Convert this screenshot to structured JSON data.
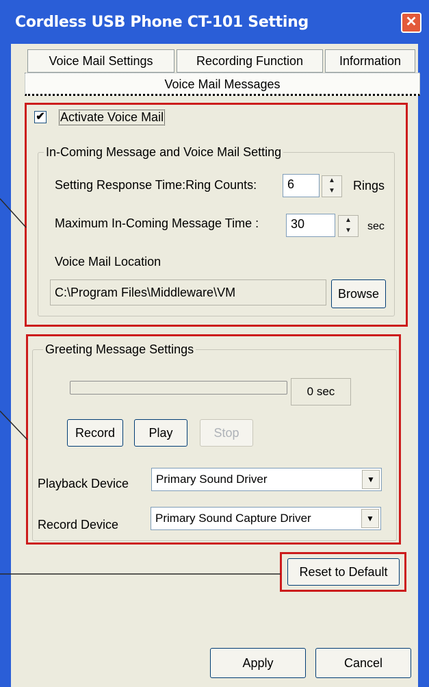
{
  "window": {
    "title": "Cordless USB Phone CT-101 Setting",
    "close_icon": "close-icon",
    "title_color": "#2a5ed7"
  },
  "tabs": [
    {
      "label": "Voice Mail Settings"
    },
    {
      "label": "Recording Function"
    },
    {
      "label": "Information"
    },
    {
      "label": "Voice Mail Messages"
    }
  ],
  "voicemail": {
    "activate_label": "Activate Voice Mail",
    "activate_checked": true,
    "group_title": "In-Coming Message and Voice Mail Setting",
    "ring_label": "Setting Response Time:Ring Counts:",
    "ring_value": "6",
    "ring_unit": "Rings",
    "max_label": "Maximum In-Coming Message Time :",
    "max_value": "30",
    "max_unit": "sec",
    "location_label": "Voice Mail Location",
    "location_value": "C:\\Program Files\\Middleware\\VM",
    "browse_label": "Browse"
  },
  "greeting": {
    "group_title": "Greeting Message Settings",
    "progress_fraction": 0,
    "time_display": "0 sec",
    "record_label": "Record",
    "play_label": "Play",
    "stop_label": "Stop",
    "playback_label": "Playback Device",
    "playback_value": "Primary Sound Driver",
    "record_device_label": "Record Device",
    "record_device_value": "Primary Sound Capture Driver"
  },
  "reset_label": "Reset to Default",
  "footer": {
    "apply_label": "Apply",
    "cancel_label": "Cancel"
  },
  "annotation_color": "#cc1c1c"
}
